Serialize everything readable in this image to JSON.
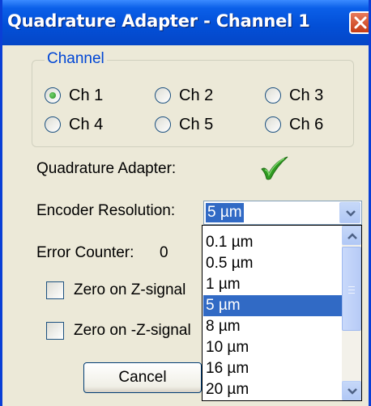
{
  "window": {
    "title": "Quadrature Adapter - Channel 1"
  },
  "channel_group": {
    "legend": "Channel",
    "options": [
      "Ch 1",
      "Ch 2",
      "Ch 3",
      "Ch 4",
      "Ch 5",
      "Ch 6"
    ],
    "selected": "Ch 1"
  },
  "adapter": {
    "label": "Quadrature Adapter:",
    "status_icon": "check-icon"
  },
  "encoder": {
    "label": "Encoder Resolution:",
    "value": "5 µm",
    "options": [
      "0.1 µm",
      "0.5 µm",
      "1 µm",
      "5 µm",
      "8 µm",
      "10 µm",
      "16 µm",
      "20 µm"
    ]
  },
  "error_counter": {
    "label": "Error Counter:",
    "value": "0"
  },
  "checkboxes": {
    "zero_z": "Zero on Z-signal",
    "zero_neg_z": "Zero on -Z-signal"
  },
  "buttons": {
    "cancel": "Cancel"
  },
  "colors": {
    "titlebar": "#0350d8",
    "selection": "#316ac5",
    "group_legend": "#0046d5",
    "check": "#2f9a21"
  }
}
